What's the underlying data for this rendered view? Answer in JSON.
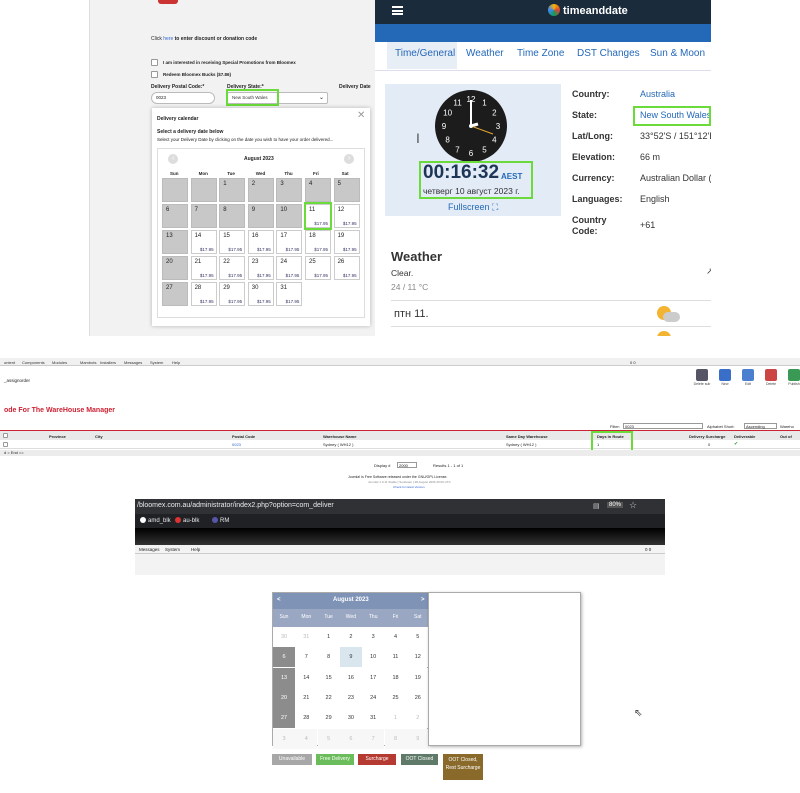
{
  "panel_a": {
    "discount_prefix": "Click",
    "discount_link": "here",
    "discount_suffix": "to enter discount or donation code",
    "promo_label": "I am interested in receiving Special Promotions from Bloomex",
    "bucks_label": "Redeem Bloomex Bucks ($7.86)",
    "postal_label": "Delivery Postal Code:*",
    "postal_value": "0023",
    "state_label": "Delivery State:*",
    "state_value": "New South Wales",
    "date_label": "Delivery Date",
    "cal_title": "Delivery calendar",
    "cal_sub": "Select a delivery date below",
    "cal_hint": "Select your Delivery Date by clicking on the date you wish to have your order delivered...",
    "month": "August 2023",
    "weekdays": [
      "Sun",
      "Mon",
      "Tue",
      "Wed",
      "Thu",
      "Fri",
      "Sat"
    ],
    "price": "$17.95",
    "days": [
      "",
      "",
      "1",
      "2",
      "3",
      "4",
      "5",
      "6",
      "7",
      "8",
      "9",
      "10",
      "11",
      "12",
      "13",
      "14",
      "15",
      "16",
      "17",
      "18",
      "19",
      "20",
      "21",
      "22",
      "23",
      "24",
      "25",
      "26",
      "27",
      "28",
      "29",
      "30",
      "31"
    ]
  },
  "panel_b": {
    "brand": "timeanddate",
    "tabs": [
      "Time/General",
      "Weather",
      "Time Zone",
      "DST Changes",
      "Sun & Moon"
    ],
    "time": "00:16:32",
    "tz": "AEST",
    "date_text": "четверг 10 август 2023 г.",
    "fullscreen": "Fullscreen",
    "rows": [
      {
        "k": "Country:",
        "v": "Australia"
      },
      {
        "k": "State:",
        "v": "New South Wales"
      },
      {
        "k": "Lat/Long:",
        "v": "33°52'S / 151°12'E"
      },
      {
        "k": "Elevation:",
        "v": "66 m"
      },
      {
        "k": "Currency:",
        "v": "Australian Dollar ("
      },
      {
        "k": "Languages:",
        "v": "English"
      },
      {
        "k": "Country Code:",
        "v": "+61"
      }
    ],
    "weather_title": "Weather",
    "weather_cond": "Clear.",
    "weather_temp": "24 / 11 °C",
    "forecast_day": "птн 11.",
    "clock_nums": [
      "12",
      "1",
      "2",
      "3",
      "4",
      "5",
      "6",
      "7",
      "8",
      "9",
      "10",
      "11"
    ]
  },
  "panel_c": {
    "menu": [
      "ontent",
      "Components",
      "Modules",
      "Mambots",
      "Installers",
      "Messages",
      "System",
      "Help"
    ],
    "menu_right": "0  0",
    "crumb": "_assignorder",
    "toolbar": [
      "Delete sub",
      "New",
      "Edit",
      "Delete",
      "Publish"
    ],
    "title": "ode For The WareHouse Manager",
    "filter_label": "Filter:",
    "filter_value": "0023",
    "alpha_label": "Alphabet Short:",
    "alpha_value": "Ascending",
    "wh_label": "Wareho",
    "headers": [
      "Province",
      "City",
      "Postal Code",
      "Warehouse Name",
      "Same Day Warehouse",
      "Days In Route",
      "Delivery Surcharge",
      "Deliverable",
      "Out of"
    ],
    "row": {
      "postal": "0023",
      "wh": "Sydney ( WH12 )",
      "same": "Sydney ( WH12 )",
      "days": "1",
      "sur": "0",
      "ok": "✔"
    },
    "pager": "Display #",
    "pager_val": "2000",
    "results": "Results 1 - 1 of 1",
    "foot1": "Joomla! is Free Software released under the GNU/GPL License.",
    "foot2": "Joomla! 1.0.11 Stable [ Sunbeam ] 28 August 2006 20:00 UTC",
    "foot3": "Check for latest Version",
    "endnote": "d = End =="
  },
  "panel_d": {
    "url": "/bloomex.com.au/administrator/index2.php?option=com_deliver",
    "zoom": "80%",
    "bookmarks": [
      "amd_blk",
      "au-blk",
      "RM"
    ],
    "menu": [
      "Messages",
      "System",
      "Help"
    ],
    "menu_right": "0  0"
  },
  "calendar2": {
    "month": "August 2023",
    "prev": "<",
    "next": ">",
    "weekdays": [
      "Sun",
      "Mon",
      "Tue",
      "Wed",
      "Thu",
      "Fri",
      "Sat"
    ],
    "weeks": [
      [
        "30",
        "31",
        "1",
        "2",
        "3",
        "4",
        "5"
      ],
      [
        "6",
        "7",
        "8",
        "9",
        "10",
        "11",
        "12"
      ],
      [
        "13",
        "14",
        "15",
        "16",
        "17",
        "18",
        "19"
      ],
      [
        "20",
        "21",
        "22",
        "23",
        "24",
        "25",
        "26"
      ],
      [
        "27",
        "28",
        "29",
        "30",
        "31",
        "1",
        "2"
      ],
      [
        "3",
        "4",
        "5",
        "6",
        "7",
        "8",
        "9"
      ]
    ],
    "legend": [
      "Unavailable",
      "Free Delivery",
      "Surcharge",
      "OOT Closed",
      "OOT Closed, Rest Surcharge"
    ],
    "legend_colors": [
      "#a7a7a7",
      "#6bbd5b",
      "#b53a32",
      "#5f7a68",
      "#8a6a2a"
    ]
  }
}
